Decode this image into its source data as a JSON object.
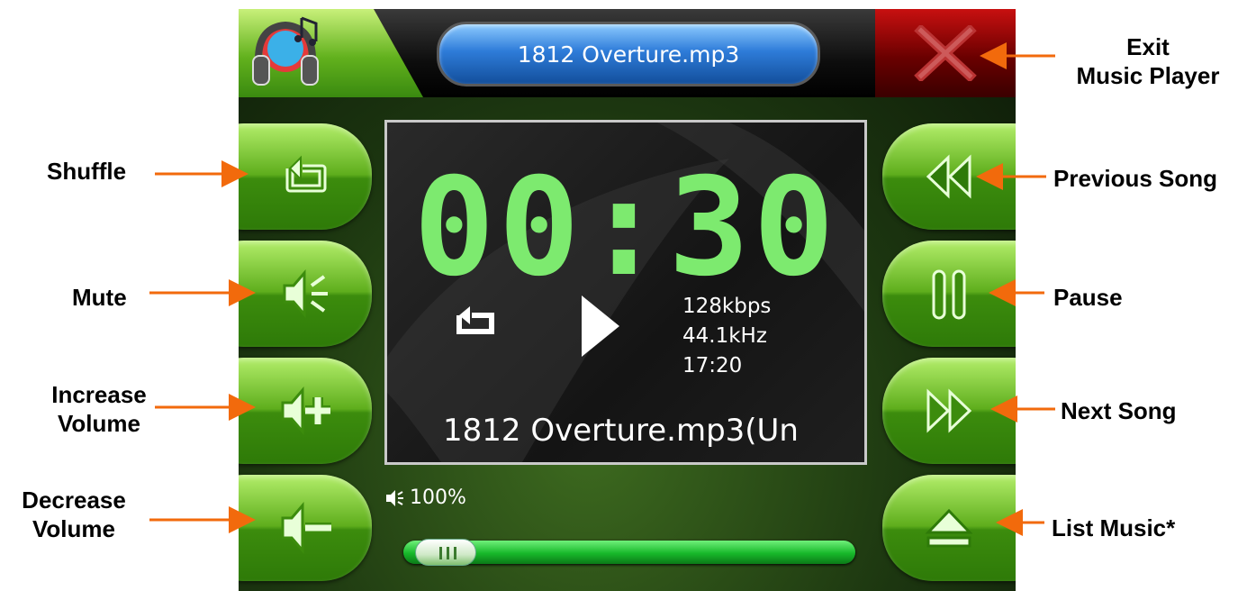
{
  "header": {
    "title": "1812 Overture.mp3",
    "logo_icon": "headphones-music-icon",
    "exit_icon": "close-x-icon"
  },
  "player": {
    "time": "00:30",
    "repeat_icon": "repeat-icon",
    "state_icon": "play-icon",
    "bitrate": "128kbps",
    "sample_rate": "44.1kHz",
    "duration": "17:20",
    "track": "1812 Overture.mp3(Un",
    "volume": "100%",
    "progress": 0.03
  },
  "buttons": {
    "left": [
      {
        "name": "shuffle-button",
        "icon": "shuffle-icon"
      },
      {
        "name": "mute-button",
        "icon": "speaker-mute-icon"
      },
      {
        "name": "increase-volume-button",
        "icon": "speaker-plus-icon"
      },
      {
        "name": "decrease-volume-button",
        "icon": "speaker-minus-icon"
      }
    ],
    "right": [
      {
        "name": "previous-song-button",
        "icon": "rewind-icon"
      },
      {
        "name": "pause-button",
        "icon": "pause-icon"
      },
      {
        "name": "next-song-button",
        "icon": "fast-forward-icon"
      },
      {
        "name": "list-music-button",
        "icon": "eject-icon"
      }
    ]
  },
  "annotations": {
    "exit_line1": "Exit",
    "exit_line2": "Music Player",
    "shuffle": "Shuffle",
    "mute": "Mute",
    "increase_line1": "Increase",
    "increase_line2": "Volume",
    "decrease_line1": "Decrease",
    "decrease_line2": "Volume",
    "previous": "Previous Song",
    "pause": "Pause",
    "next": "Next Song",
    "list": "List Music*"
  },
  "colors": {
    "arrow": "#f26a0c",
    "time_digits": "#7dea6f",
    "button_green": "#5fae1d",
    "title_blue": "#2e7cd9",
    "exit_red": "#8a0000"
  }
}
